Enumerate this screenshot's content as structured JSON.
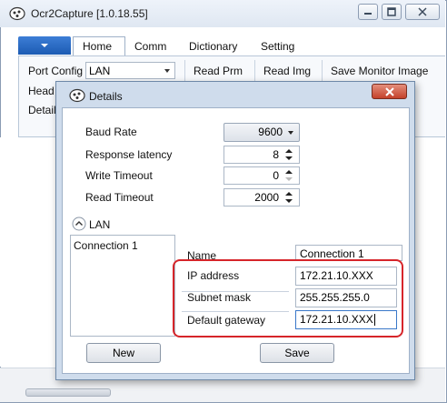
{
  "window": {
    "title": "Ocr2Capture [1.0.18.55]",
    "controls": [
      "minimize-icon",
      "restore-icon",
      "close-icon"
    ]
  },
  "ribbon": {
    "tabs": [
      "Home",
      "Comm",
      "Dictionary",
      "Setting"
    ],
    "active_tab": "Home",
    "port_config_label": "Port Config",
    "port_config_value": "LAN",
    "read_prm": "Read Prm",
    "read_img": "Read Img",
    "save_monitor_image": "Save Monitor Image",
    "head_label": "Head N",
    "details_label": "Details"
  },
  "dialog": {
    "title": "Details",
    "baud_rate_label": "Baud Rate",
    "baud_rate_value": "9600",
    "response_latency_label": "Response latency",
    "response_latency_value": "8",
    "write_timeout_label": "Write Timeout",
    "write_timeout_value": "0",
    "read_timeout_label": "Read Timeout",
    "read_timeout_value": "2000",
    "lan_section_label": "LAN",
    "connections": [
      "Connection 1"
    ],
    "name_label": "Name",
    "name_value": "Connection 1",
    "ip_label": "IP address",
    "ip_value": "172.21.10.XXX",
    "subnet_label": "Subnet mask",
    "subnet_value": "255.255.255.0",
    "gateway_label": "Default gateway",
    "gateway_value": "172.21.10.XXX",
    "new_button": "New",
    "save_button": "Save"
  },
  "colors": {
    "highlight": "#d6252a",
    "file_button": "#1c5bb3",
    "dialog_frame": "#cfdcec",
    "close_button": "#c4412a"
  }
}
